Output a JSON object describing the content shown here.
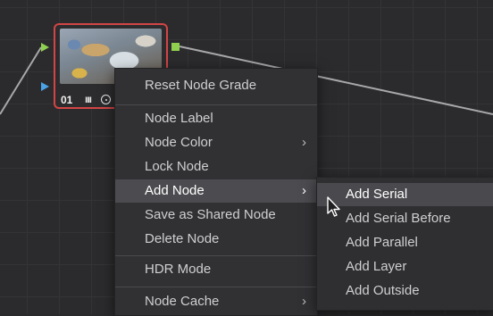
{
  "node": {
    "number": "01",
    "bars_glyph": "ııı"
  },
  "context_menu": {
    "items": [
      {
        "label": "Reset Node Grade"
      },
      {
        "label": "Node Label"
      },
      {
        "label": "Node Color",
        "submenu": true,
        "chevron": "›"
      },
      {
        "label": "Lock Node"
      },
      {
        "label": "Add Node",
        "submenu": true,
        "active": true,
        "chevron": "›"
      },
      {
        "label": "Save as Shared Node"
      },
      {
        "label": "Delete Node"
      },
      {
        "label": "HDR Mode"
      },
      {
        "label": "Node Cache",
        "submenu": true,
        "chevron": "›"
      }
    ]
  },
  "submenu": {
    "items": [
      {
        "label": "Add Serial",
        "active": true
      },
      {
        "label": "Add Serial Before"
      },
      {
        "label": "Add Parallel"
      },
      {
        "label": "Add Layer"
      },
      {
        "label": "Add Outside"
      }
    ]
  },
  "colors": {
    "selected_border": "#d24545",
    "input_green": "#8fd14f",
    "input_blue": "#4aa3e6",
    "menu_bg": "#313134",
    "menu_highlight": "#4c4c50"
  },
  "icons": [
    "clock-icon",
    "chevron-right-icon",
    "mouse-pointer-icon"
  ]
}
